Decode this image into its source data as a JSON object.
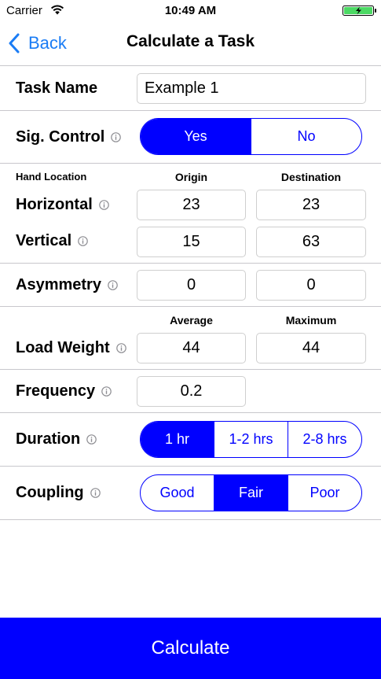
{
  "status_bar": {
    "carrier": "Carrier",
    "time": "10:49 AM",
    "icons": [
      "wifi-icon",
      "battery-charging-icon"
    ]
  },
  "nav": {
    "back_label": "Back",
    "title": "Calculate a Task"
  },
  "task_name": {
    "label": "Task Name",
    "value": "Example 1"
  },
  "sig_control": {
    "label": "Sig. Control",
    "options": [
      "Yes",
      "No"
    ],
    "selected": "Yes"
  },
  "hand_location": {
    "header": "Hand Location",
    "origin_header": "Origin",
    "destination_header": "Destination",
    "horizontal": {
      "label": "Horizontal",
      "origin": "23",
      "destination": "23"
    },
    "vertical": {
      "label": "Vertical",
      "origin": "15",
      "destination": "63"
    }
  },
  "asymmetry": {
    "label": "Asymmetry",
    "origin": "0",
    "destination": "0"
  },
  "load_weight": {
    "average_header": "Average",
    "maximum_header": "Maximum",
    "label": "Load Weight",
    "average": "44",
    "maximum": "44"
  },
  "frequency": {
    "label": "Frequency",
    "value": "0.2"
  },
  "duration": {
    "label": "Duration",
    "options": [
      "1 hr",
      "1-2 hrs",
      "2-8 hrs"
    ],
    "selected": "1 hr"
  },
  "coupling": {
    "label": "Coupling",
    "options": [
      "Good",
      "Fair",
      "Poor"
    ],
    "selected": "Fair"
  },
  "calculate_label": "Calculate",
  "colors": {
    "accent": "#0000ff",
    "back_link": "#1a7cf5",
    "divider": "#c8c7cc",
    "battery": "#4cd964"
  }
}
